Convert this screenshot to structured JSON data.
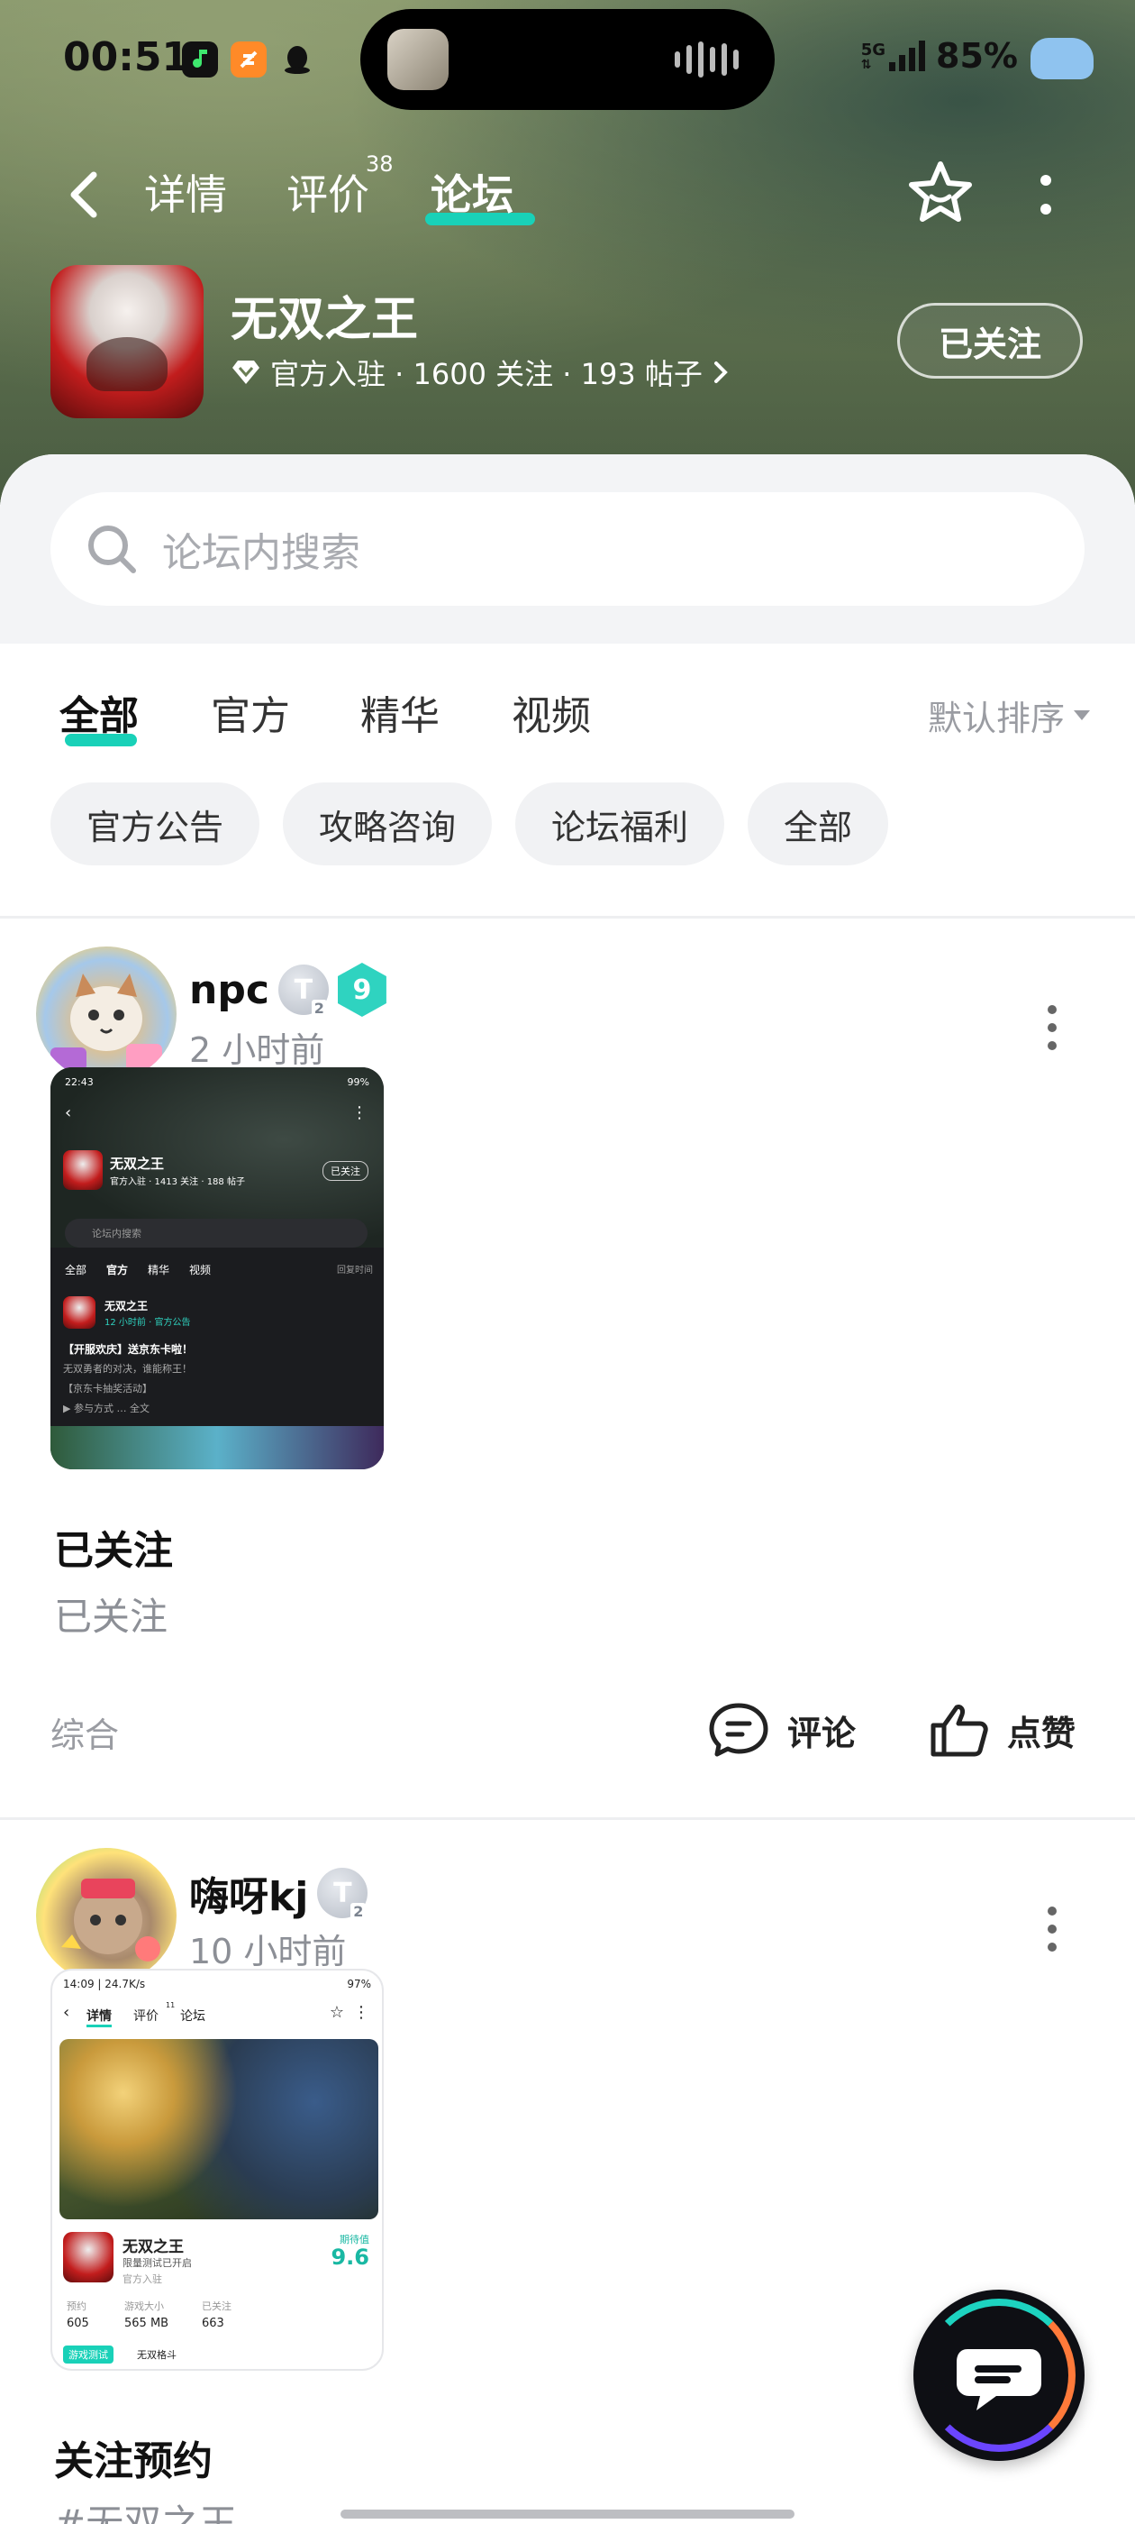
{
  "status_bar": {
    "time": "00:51",
    "battery": "85%",
    "network": "5G"
  },
  "nav": {
    "tabs": [
      {
        "label": "详情"
      },
      {
        "label": "评价",
        "badge": "38"
      },
      {
        "label": "论坛",
        "active": true
      }
    ]
  },
  "game": {
    "title": "无双之王",
    "meta": "官方入驻 · 1600 关注 · 193 帖子",
    "follow_label": "已关注"
  },
  "search": {
    "placeholder": "论坛内搜索"
  },
  "tabs": {
    "items": [
      "全部",
      "官方",
      "精华",
      "视频"
    ],
    "sort_label": "默认排序"
  },
  "chips": [
    "官方公告",
    "攻略咨询",
    "论坛福利",
    "全部"
  ],
  "posts": [
    {
      "author": "npc",
      "level_badge": "T",
      "level_sub": "2",
      "rank": "9",
      "time": "2 小时前",
      "title": "已关注",
      "body": "已关注",
      "category": "综合",
      "comment_label": "评论",
      "like_label": "点赞",
      "shot": {
        "time": "22:43",
        "battery": "99%",
        "game": "无双之王",
        "meta": "官方入驻 · 1413 关注 · 188 帖子",
        "follow": "已关注",
        "search": "论坛内搜索",
        "tabs": [
          "全部",
          "官方",
          "精华",
          "视频"
        ],
        "sort": "回复时间",
        "post_author": "无双之王",
        "post_meta": "12 小时前 · 官方公告",
        "post_title": "【开服欢庆】送京东卡啦！",
        "post_line1": "无双勇者的对决，谁能称王！",
        "post_line2": "【京东卡抽奖活动】",
        "post_line3": "▶ 参与方式 … 全文"
      }
    },
    {
      "author": "嗨呀kj",
      "level_badge": "T",
      "level_sub": "2",
      "time": "10 小时前",
      "title": "关注预约",
      "body": "#无双之王",
      "shot": {
        "status": "14:09 | 24.7K/s",
        "battery": "97%",
        "tabs": [
          "详情",
          "评价",
          "论坛"
        ],
        "tab_badge": "11",
        "game": "无双之王",
        "sub1": "限量测试已开启",
        "sub2": "官方入驻",
        "score_label": "期待值",
        "score": "9.6",
        "stats_labels": [
          "预约",
          "游戏大小",
          "已关注"
        ],
        "stats_values": [
          "605",
          "565 MB",
          "663"
        ],
        "tag": "游戏测试",
        "tag2": "无双格斗"
      }
    }
  ]
}
